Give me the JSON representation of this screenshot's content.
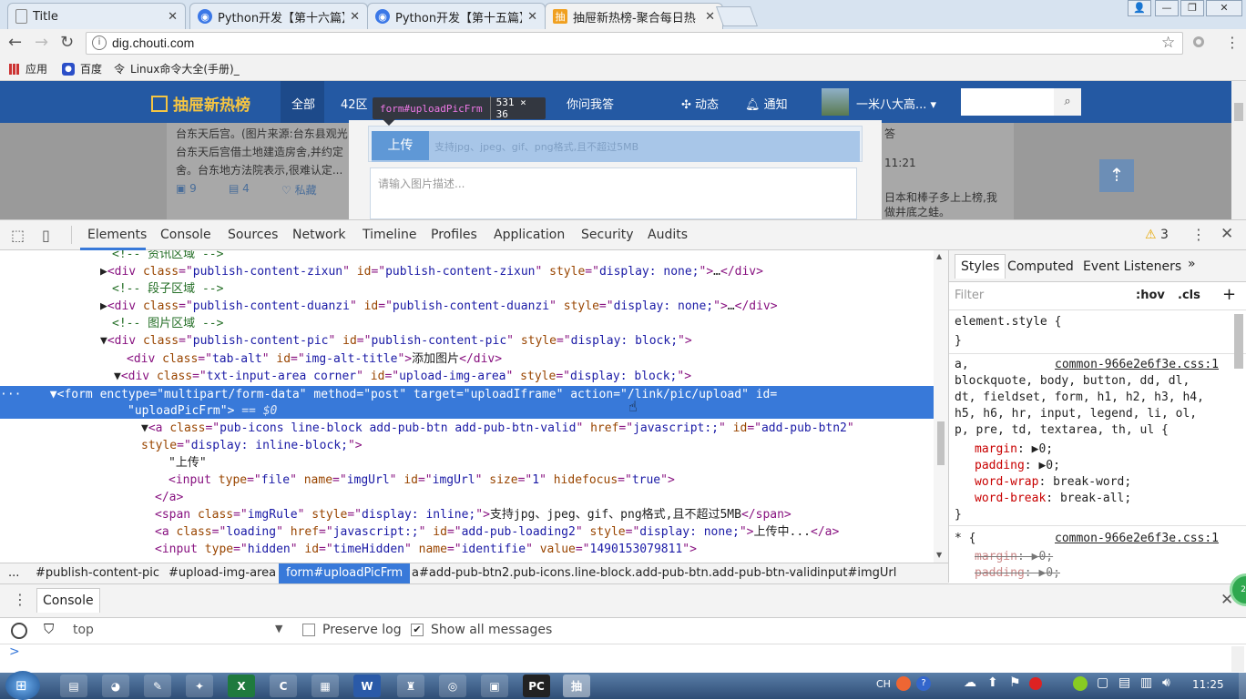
{
  "tabs": [
    {
      "label": "Title",
      "active": false
    },
    {
      "label": "Python开发【第十六篇】",
      "active": false
    },
    {
      "label": "Python开发【第十五篇】",
      "active": false
    },
    {
      "label": "抽屉新热榜-聚合每日热",
      "active": true
    }
  ],
  "address": {
    "url": "dig.chouti.com"
  },
  "bookmarks": [
    {
      "label": "应用",
      "icon": "apps-grid-icon"
    },
    {
      "label": "百度",
      "icon": "baidu-paw-icon"
    },
    {
      "label": "Linux命令大全(手册)_",
      "icon": "linux-icon"
    }
  ],
  "site": {
    "logo": "抽屉新热榜",
    "nav": [
      "全部",
      "42区",
      "你问我答"
    ],
    "dynamic": "动态",
    "notify": "通知",
    "user": "一米八大高...",
    "bg_text": [
      "台东天后宫。(图片来源:台东县观光",
      "台东天后宫借土地建造房舍,并约定",
      "舍。台东地方法院表示,很难认定...",
      "答",
      "11:21",
      "日本和棒子多上上榜,我",
      "做井底之蛙。"
    ],
    "counts": {
      "likes": "9",
      "comments": "4",
      "fav": "私藏"
    }
  },
  "modal": {
    "upload_btn": "上传",
    "upload_rule": "支持jpg、jpeg、gif、png格式,且不超过5MB",
    "desc_placeholder": "请输入图片描述..."
  },
  "tooltip": {
    "selector": "form#uploadPicFrm",
    "size": "531 × 36"
  },
  "devtools": {
    "tabs": [
      "Elements",
      "Console",
      "Sources",
      "Network",
      "Timeline",
      "Profiles",
      "Application",
      "Security",
      "Audits"
    ],
    "warnings": "3",
    "breadcrumbs": [
      "...",
      "#publish-content-pic",
      "#upload-img-area",
      "form#uploadPicFrm",
      "a#add-pub-btn2.pub-icons.line-block.add-pub-btn.add-pub-btn-valid",
      "input#imgUrl"
    ],
    "dom": {
      "c1": "<!-- 资讯区域 -->",
      "l2": {
        "class": "publish-content-zixun",
        "id": "publish-content-zixun",
        "style": "display: none;"
      },
      "c3": "<!-- 段子区域 -->",
      "l4": {
        "class": "publish-content-duanzi",
        "id": "publish-content-duanzi",
        "style": "display: none;"
      },
      "c5": "<!-- 图片区域 -->",
      "l6": {
        "class": "publish-content-pic",
        "id": "publish-content-pic",
        "style": "display: block;"
      },
      "l7": {
        "class": "tab-alt",
        "id": "img-alt-title",
        "text": "添加图片"
      },
      "l8": {
        "class": "txt-input-area corner",
        "id": "upload-img-area",
        "style": "display: block;"
      },
      "form": {
        "enctype": "multipart/form-data",
        "method": "post",
        "target": "uploadIframe",
        "action": "/link/pic/upload",
        "id": "uploadPicFrm",
        "eq": "== $0"
      },
      "a": {
        "class": "pub-icons line-block add-pub-btn add-pub-btn-valid",
        "href": "javascript:;",
        "id": "add-pub-btn2",
        "style": "display: inline-block;"
      },
      "txt_upload": "\"上传\"",
      "input": {
        "type": "file",
        "name": "imgUrl",
        "id": "imgUrl",
        "size": "1",
        "hidefocus": "true"
      },
      "span": {
        "class": "imgRule",
        "style": "display: inline;",
        "text": "支持jpg、jpeg、gif、png格式,且不超过5MB"
      },
      "loading": {
        "class": "loading",
        "href": "javascript:;",
        "id": "add-pub-loading2",
        "style": "display: none;",
        "text": "上传中..."
      },
      "hidden": {
        "type": "hidden",
        "id": "timeHidden",
        "name": "identifie",
        "value": "1490153079811"
      }
    },
    "styles": {
      "tabs": [
        "Styles",
        "Computed",
        "Event Listeners"
      ],
      "filter": "Filter",
      "hov": ":hov",
      "cls": ".cls",
      "element_style": "element.style {",
      "close": "}",
      "source": "common-966e2e6f3e.css:1",
      "selector1": "a,\nblockquote, body, button, dd, dl,\ndt, fieldset, form, h1, h2, h3, h4,\nh5, h6, hr, input, legend, li, ol,\np, pre, td, textarea, th, ul {",
      "props": [
        {
          "name": "margin",
          "value": "0;"
        },
        {
          "name": "padding",
          "value": "0;"
        },
        {
          "name": "word-wrap",
          "value": "break-word;"
        },
        {
          "name": "word-break",
          "value": "break-all;"
        }
      ],
      "selector2": "* {",
      "struck": [
        {
          "name": "margin",
          "value": "0;"
        },
        {
          "name": "padding",
          "value": "0;"
        }
      ]
    },
    "console": {
      "title": "Console",
      "context": "top",
      "preserve_log": "Preserve log",
      "show_all": "Show all messages",
      "prompt": ">"
    }
  },
  "taskbar": {
    "time": "11:25",
    "lang": "CH"
  }
}
